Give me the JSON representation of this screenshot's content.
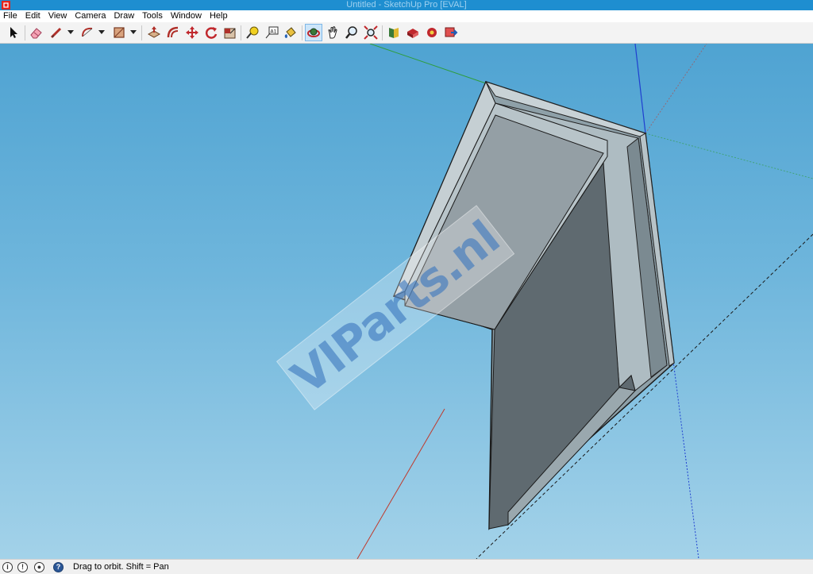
{
  "window": {
    "title": "Untitled - SketchUp Pro [EVAL]"
  },
  "menu": {
    "items": [
      "File",
      "Edit",
      "View",
      "Camera",
      "Draw",
      "Tools",
      "Window",
      "Help"
    ]
  },
  "toolbar": {
    "tools": [
      {
        "name": "select-tool-icon"
      },
      {
        "name": "eraser-tool-icon"
      },
      {
        "name": "line-tool-icon"
      },
      {
        "name": "arc-tool-icon"
      },
      {
        "name": "rectangle-tool-icon"
      },
      {
        "name": "push-pull-tool-icon"
      },
      {
        "name": "offset-tool-icon"
      },
      {
        "name": "move-tool-icon"
      },
      {
        "name": "rotate-tool-icon"
      },
      {
        "name": "scale-tool-icon"
      },
      {
        "name": "tape-measure-tool-icon"
      },
      {
        "name": "text-tool-icon"
      },
      {
        "name": "paint-bucket-tool-icon"
      },
      {
        "name": "orbit-tool-icon"
      },
      {
        "name": "pan-tool-icon"
      },
      {
        "name": "zoom-tool-icon"
      },
      {
        "name": "zoom-extents-tool-icon"
      },
      {
        "name": "3d-warehouse-icon"
      },
      {
        "name": "extension-warehouse-icon"
      },
      {
        "name": "components-icon"
      },
      {
        "name": "send-to-layout-icon"
      }
    ],
    "active_tool": "orbit-tool-icon"
  },
  "viewport": {
    "watermark_text": "VIParts.nl"
  },
  "colors": {
    "titlebar": "#1e8ed0",
    "sky_top": "#4fa3d2",
    "sky_bottom": "#a3d2e9",
    "axis_red": "#c0392b",
    "axis_green": "#2e9e3c",
    "axis_blue": "#1f3fd0"
  },
  "status": {
    "hint": "Drag to orbit.  Shift = Pan",
    "icons": [
      "geo-location-icon",
      "credits-icon",
      "user-icon",
      "help-icon"
    ]
  }
}
